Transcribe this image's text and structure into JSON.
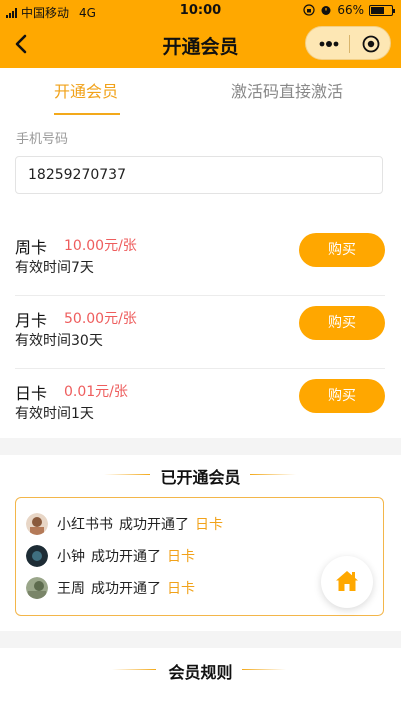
{
  "status_bar": {
    "carrier": "中国移动",
    "network": "4G",
    "time": "10:00",
    "battery": "66%"
  },
  "nav": {
    "title": "开通会员",
    "back_icon": "back-arrow-icon",
    "more_icon": "more-dots-icon",
    "close_icon": "target-circle-icon"
  },
  "tabs": [
    {
      "label": "开通会员",
      "active": true
    },
    {
      "label": "激活码直接激活",
      "active": false
    }
  ],
  "form": {
    "phone_label": "手机号码",
    "phone_value": "18259270737"
  },
  "plans": [
    {
      "name": "周卡",
      "price": "10.00元/张",
      "valid": "有效时间7天",
      "button": "购买"
    },
    {
      "name": "月卡",
      "price": "50.00元/张",
      "valid": "有效时间30天",
      "button": "购买"
    },
    {
      "name": "日卡",
      "price": "0.01元/张",
      "valid": "有效时间1天",
      "button": "购买"
    }
  ],
  "members": {
    "title": "已开通会员",
    "list": [
      {
        "user": "小红书书",
        "action": "成功开通了",
        "plan": "日卡"
      },
      {
        "user": "小钟",
        "action": "成功开通了",
        "plan": "日卡"
      },
      {
        "user": "王周",
        "action": "成功开通了",
        "plan": "日卡"
      }
    ]
  },
  "rules": {
    "title": "会员规则"
  },
  "floating": {
    "home_icon": "home-icon"
  },
  "colors": {
    "accent": "#ffa800",
    "price": "#ee5d5d",
    "active_tab": "#f1a21a"
  }
}
